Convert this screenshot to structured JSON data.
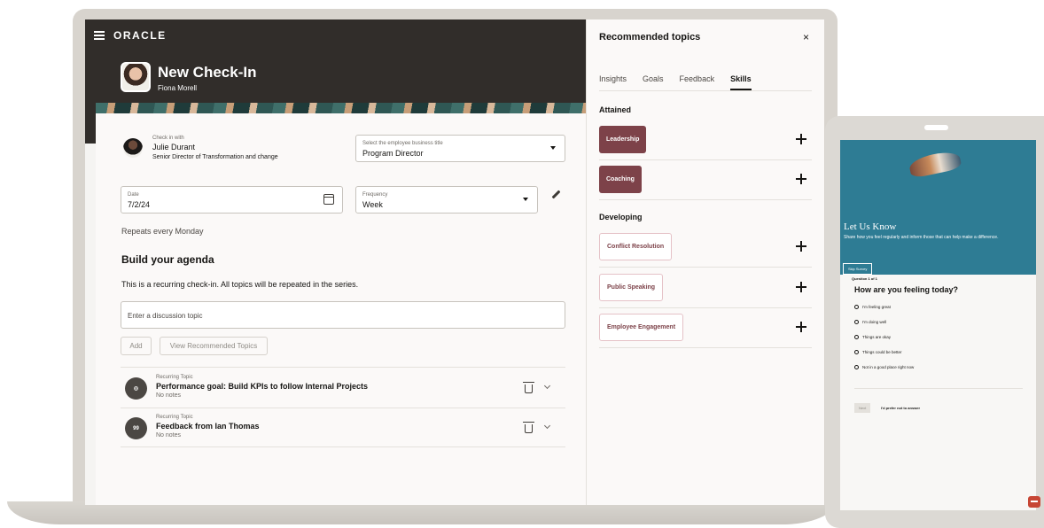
{
  "app": {
    "brand": "ORACLE",
    "page_title": "New Check-In",
    "page_subtitle": "Fiona Morell"
  },
  "checkin": {
    "label": "Check in with",
    "name": "Julie Durant",
    "role": "Senior Director of Transformation and change"
  },
  "business_title": {
    "label": "Select the employee business title",
    "value": "Program Director"
  },
  "date": {
    "label": "Date",
    "value": "7/2/24"
  },
  "frequency": {
    "label": "Frequency",
    "value": "Week"
  },
  "repeats": "Repeats every Monday",
  "agenda": {
    "title": "Build your agenda",
    "description": "This is a recurring check-in. All topics will be repeated in the series.",
    "input_placeholder": "Enter a discussion topic",
    "add_label": "Add",
    "view_recommended_label": "View Recommended Topics",
    "topics": [
      {
        "kind": "Recurring Topic",
        "title": "Performance goal: Build KPIs to follow Internal Projects",
        "notes": "No notes",
        "icon": "target-icon"
      },
      {
        "kind": "Recurring Topic",
        "title": "Feedback from Ian Thomas",
        "notes": "No notes",
        "icon": "quote-icon",
        "icon_text": "99"
      }
    ]
  },
  "drawer": {
    "title": "Recommended topics",
    "close": "×",
    "tabs": [
      "Insights",
      "Goals",
      "Feedback",
      "Skills"
    ],
    "active_tab": "Skills",
    "attained_title": "Attained",
    "attained": [
      "Leadership",
      "Coaching"
    ],
    "developing_title": "Developing",
    "developing": [
      "Conflict Resolution",
      "Public Speaking",
      "Employee Engagement"
    ],
    "chip_color": "#7d4249"
  },
  "survey": {
    "heading": "Let Us Know",
    "description": "Share how you feel regularly and inform those that can help make a difference.",
    "skip_label": "Skip Survey",
    "question_count": "Question 1 of 1",
    "question": "How are you feeling today?",
    "options": [
      "I'm feeling great",
      "I'm doing well",
      "Things are okay",
      "Things could be better",
      "Not in a good place right now"
    ],
    "next_label": "Next",
    "prefer_label": "I'd prefer not to answer",
    "banner_color": "#2e7c94"
  }
}
